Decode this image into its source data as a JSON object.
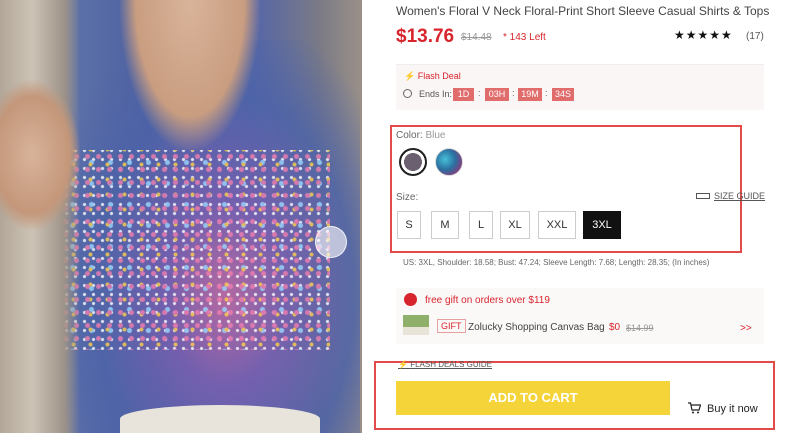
{
  "product": {
    "title": "Women's Floral V Neck Floral-Print Short Sleeve Casual Shirts & Tops",
    "price": "$13.76",
    "old_price": "$14.48",
    "left_count": "* 143 Left",
    "stars": "★★★★★",
    "review_count": "(17)"
  },
  "flash": {
    "label": "Flash Deal",
    "ends_label": "Ends In:",
    "days": "1D",
    "hours": "03H",
    "minutes": "19M",
    "seconds": "34S",
    "sep": ":"
  },
  "color": {
    "label": "Color:",
    "selected": "Blue",
    "swatches": [
      "swatch-blue",
      "swatch-teal-purple"
    ]
  },
  "size": {
    "label": "Size:",
    "guide": "SIZE GUIDE",
    "options": [
      "S",
      "M",
      "L",
      "XL",
      "XXL",
      "3XL"
    ],
    "selected": "3XL"
  },
  "measurements": "US: 3XL,   Shoulder: 18.58;   Bust: 47.24;   Sleeve Length: 7.68;   Length: 28.35;   (In inches)",
  "gift": {
    "message": "free gift on orders over $119",
    "tag": "GIFT",
    "name": "Zolucky Shopping Canvas Bag",
    "price": "$0",
    "old_price": "$14.99",
    "arrow": ">>"
  },
  "actions": {
    "flash_guide": "FLASH DEALS GUIDE",
    "add_to_cart": "ADD TO CART",
    "buy_now": "Buy it now"
  },
  "colors": {
    "accent": "#d8242c",
    "highlight": "#e34a4a",
    "cart_button": "#f5d43a"
  }
}
